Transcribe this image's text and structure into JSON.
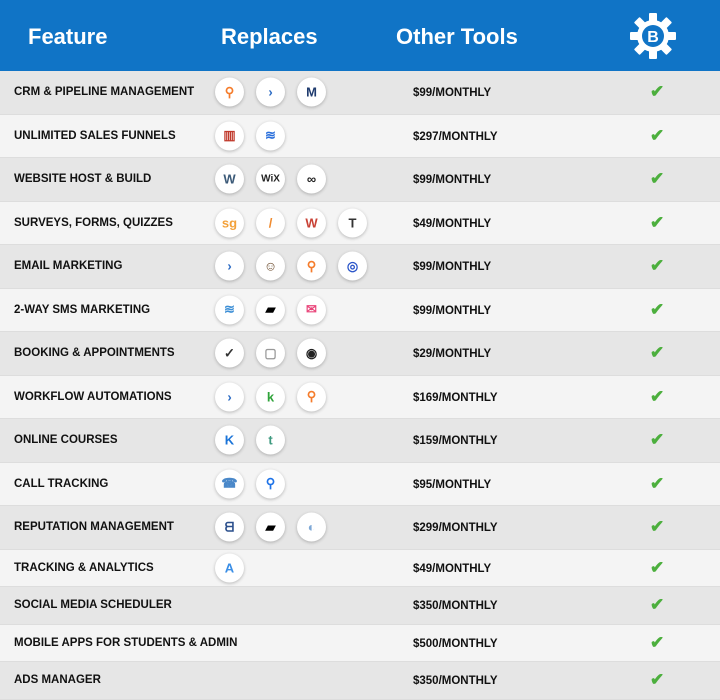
{
  "header": {
    "feature": "Feature",
    "replaces": "Replaces",
    "other_tools": "Other Tools",
    "logo_letter": "B"
  },
  "colors": {
    "header": "#1074c6",
    "check": "#4caf3d"
  },
  "rows": [
    {
      "feature": "CRM & PIPELINE MANAGEMENT",
      "price": "$99/MONTHLY",
      "icons": [
        [
          "hubspot-icon",
          "⚲",
          "#f57c2b"
        ],
        [
          "activecampaign-icon",
          "›",
          "#2c6bc4"
        ],
        [
          "keap-icon",
          "M",
          "#1f3b6e"
        ]
      ]
    },
    {
      "feature": "UNLIMITED SALES FUNNELS",
      "price": "$297/MONTHLY",
      "icons": [
        [
          "clickfunnels-icon",
          "▥",
          "#c0392b"
        ],
        [
          "leadpages-icon",
          "≋",
          "#2a6fdb"
        ]
      ]
    },
    {
      "feature": "WEBSITE HOST & BUILD",
      "price": "$99/MONTHLY",
      "icons": [
        [
          "wordpress-icon",
          "W",
          "#3c5a78"
        ],
        [
          "wix-icon",
          "WiX",
          "#222"
        ],
        [
          "squarespace-icon",
          "∞",
          "#222"
        ]
      ]
    },
    {
      "feature": "SURVEYS, FORMS, QUIZZES",
      "price": "$49/MONTHLY",
      "icons": [
        [
          "surveygizmo-icon",
          "sg",
          "#f3a13a"
        ],
        [
          "jotform-icon",
          "/",
          "#f08b2f"
        ],
        [
          "wufoo-icon",
          "W",
          "#c94236"
        ],
        [
          "typeform-icon",
          "T",
          "#333"
        ]
      ]
    },
    {
      "feature": "EMAIL MARKETING",
      "price": "$99/MONTHLY",
      "icons": [
        [
          "activecampaign-icon",
          "›",
          "#2c6bc4"
        ],
        [
          "mailchimp-icon",
          "☺",
          "#6b4a2b"
        ],
        [
          "hubspot-icon",
          "⚲",
          "#f57c2b"
        ],
        [
          "constant-contact-icon",
          "◎",
          "#2a55c9"
        ]
      ]
    },
    {
      "feature": "2-WAY SMS MARKETING",
      "price": "$99/MONTHLY",
      "icons": [
        [
          "sms-chevrons-icon",
          "≋",
          "#3d8fd6"
        ],
        [
          "podium-icon",
          "▰",
          "#000"
        ],
        [
          "textline-icon",
          "✉",
          "#e9457a"
        ]
      ]
    },
    {
      "feature": "BOOKING & APPOINTMENTS",
      "price": "$29/MONTHLY",
      "icons": [
        [
          "calendly-icon",
          "✓",
          "#333"
        ],
        [
          "calendar-icon",
          "▢",
          "#999"
        ],
        [
          "acuity-icon",
          "◉",
          "#222"
        ]
      ]
    },
    {
      "feature": "WORKFLOW AUTOMATIONS",
      "price": "$169/MONTHLY",
      "icons": [
        [
          "activecampaign-icon",
          "›",
          "#2c6bc4"
        ],
        [
          "keap-k-icon",
          "k",
          "#2fa33a"
        ],
        [
          "hubspot-icon",
          "⚲",
          "#f57c2b"
        ]
      ]
    },
    {
      "feature": "ONLINE COURSES",
      "price": "$159/MONTHLY",
      "icons": [
        [
          "kajabi-icon",
          "K",
          "#1b74d8"
        ],
        [
          "teachable-icon",
          "t",
          "#3f9a80"
        ]
      ]
    },
    {
      "feature": "CALL TRACKING",
      "price": "$95/MONTHLY",
      "icons": [
        [
          "callrail-icon",
          "☎",
          "#4a88c9"
        ],
        [
          "calltrackingmetrics-icon",
          "⚲",
          "#1e73e8"
        ]
      ]
    },
    {
      "feature": "REPUTATION MANAGEMENT",
      "price": "$299/MONTHLY",
      "icons": [
        [
          "birdeye-icon",
          "ᗺ",
          "#2b4f8c"
        ],
        [
          "podium-icon",
          "▰",
          "#000"
        ],
        [
          "reputation-icon",
          "◐",
          "#7ea8d6"
        ]
      ]
    },
    {
      "feature": "TRACKING & ANALYTICS",
      "price": "$49/MONTHLY",
      "icons": [
        [
          "analytics-icon",
          "A",
          "#3a8ee6"
        ]
      ]
    },
    {
      "feature": "SOCIAL MEDIA SCHEDULER",
      "price": "$350/MONTHLY",
      "icons": []
    },
    {
      "feature": "MOBILE APPS FOR STUDENTS & ADMIN",
      "price": "$500/MONTHLY",
      "icons": []
    },
    {
      "feature": "ADS MANAGER",
      "price": "$350/MONTHLY",
      "icons": []
    }
  ],
  "check_symbol": "✔"
}
